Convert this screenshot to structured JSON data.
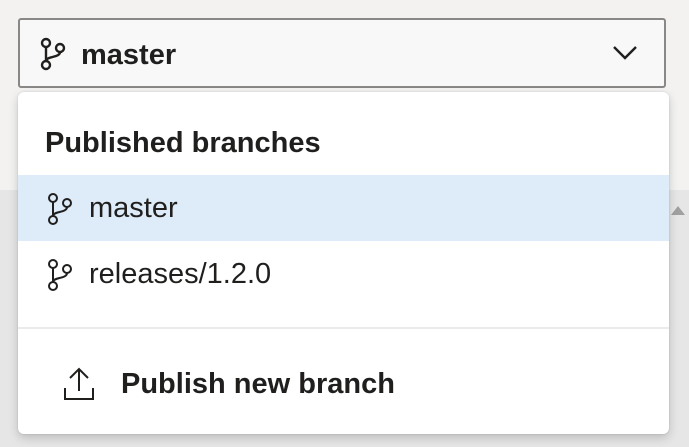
{
  "branch_selector": {
    "selected_branch": "master",
    "icon": "git-branch-icon",
    "chevron_icon": "chevron-down-icon"
  },
  "dropdown": {
    "section_header": "Published branches",
    "branches": [
      {
        "label": "master",
        "icon": "git-branch-icon",
        "selected": true
      },
      {
        "label": "releases/1.2.0",
        "icon": "git-branch-icon",
        "selected": false
      }
    ],
    "action": {
      "label": "Publish new branch",
      "icon": "upload-icon"
    }
  },
  "colors": {
    "selected_row_bg": "#deecf9",
    "text": "#201f1e",
    "border": "#8a8886"
  }
}
